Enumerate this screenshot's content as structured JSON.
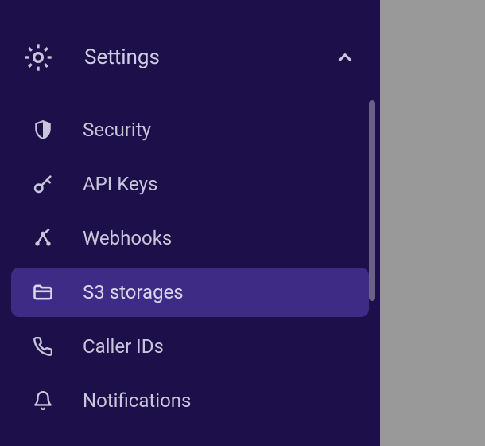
{
  "settings": {
    "header_label": "Settings",
    "items": [
      {
        "id": "security",
        "label": "Security",
        "icon": "shield-icon"
      },
      {
        "id": "api-keys",
        "label": "API Keys",
        "icon": "key-icon"
      },
      {
        "id": "webhooks",
        "label": "Webhooks",
        "icon": "webhook-icon"
      },
      {
        "id": "s3-storages",
        "label": "S3 storages",
        "icon": "folder-icon",
        "active": true
      },
      {
        "id": "caller-ids",
        "label": "Caller IDs",
        "icon": "phone-icon"
      },
      {
        "id": "notifications",
        "label": "Notifications",
        "icon": "bell-icon"
      }
    ]
  },
  "colors": {
    "sidebar_bg": "#1d0f4a",
    "active_bg": "#3e2b86",
    "text": "#c9c5da"
  }
}
